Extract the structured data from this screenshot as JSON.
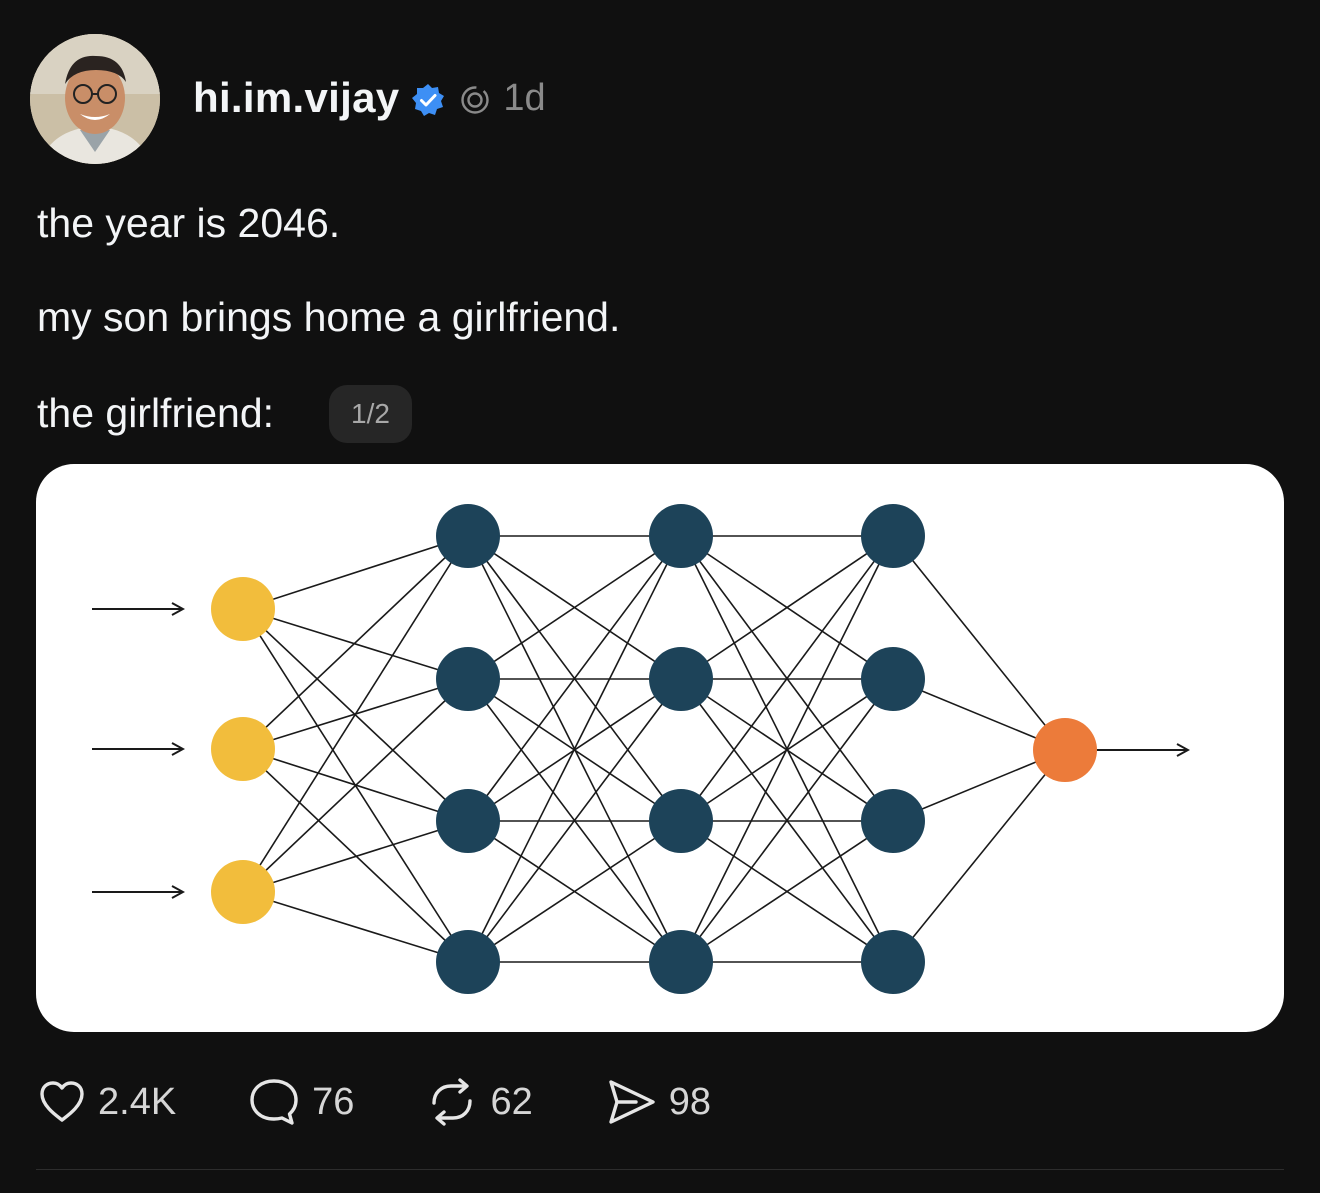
{
  "post": {
    "username": "hi.im.vijay",
    "timestamp": "1d",
    "lines": [
      "the year is 2046.",
      "my son brings home a girlfriend.",
      "the girlfriend:"
    ],
    "page_indicator": "1/2"
  },
  "icons": {
    "verified": "verified-badge-icon",
    "threads": "threads-logo-icon",
    "like": "heart-icon",
    "reply": "speech-bubble-icon",
    "repost": "repost-icon",
    "share": "paper-plane-icon"
  },
  "actions": {
    "likes": "2.4K",
    "replies": "76",
    "reposts": "62",
    "shares": "98"
  },
  "colors": {
    "background": "#101010",
    "verified": "#3d8ff5",
    "input_node": "#f2bd3c",
    "hidden_node": "#1d4359",
    "output_node": "#ec7b3a"
  }
}
